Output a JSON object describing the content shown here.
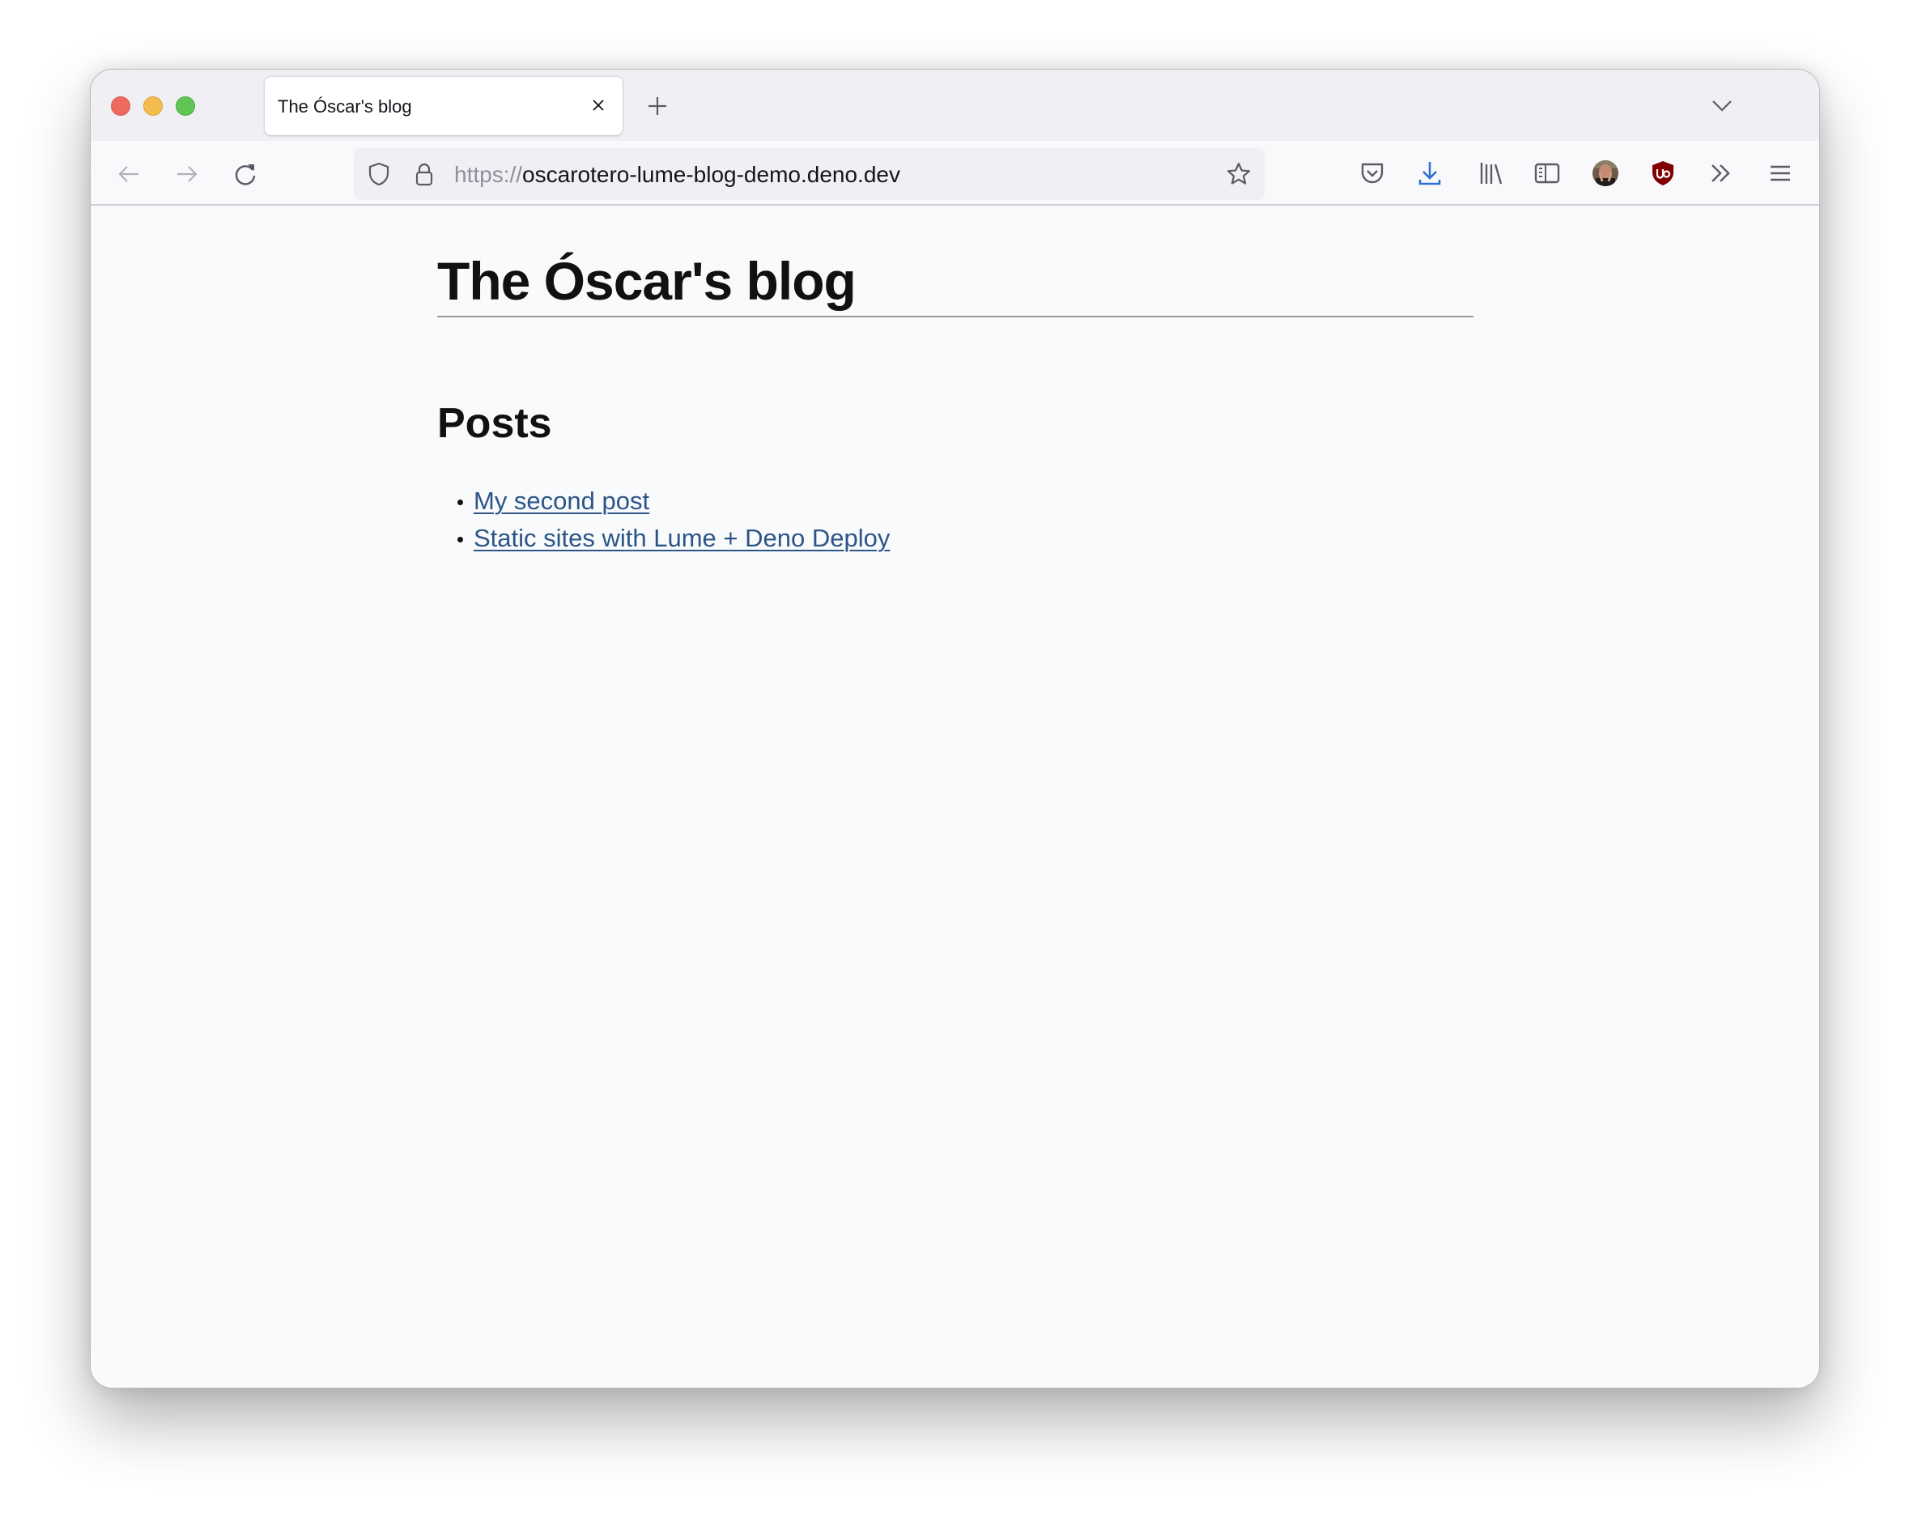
{
  "browser": {
    "tabs": [
      {
        "title": "The Óscar's blog",
        "active": true
      }
    ],
    "url": {
      "scheme": "https://",
      "host": "oscarotero-lume-blog-demo.deno.dev"
    },
    "icons": {
      "window_controls": [
        "close-dot",
        "minimize-dot",
        "maximize-dot"
      ],
      "nav": [
        "back-arrow-icon",
        "forward-arrow-icon",
        "reload-icon"
      ],
      "urlbar": [
        "tracking-shield-icon",
        "lock-icon",
        "bookmark-star-icon"
      ],
      "toolbar": [
        "pocket-icon",
        "download-icon",
        "library-icon",
        "sidebar-icon",
        "account-avatar",
        "ublock-origin-icon",
        "overflow-chevrons-icon",
        "hamburger-menu-icon"
      ]
    },
    "colors": {
      "download_accent": "#2f6fd6",
      "ublock_red": "#800000",
      "link": "#2c5587"
    }
  },
  "page": {
    "site_title": "The Óscar's blog",
    "section_title": "Posts",
    "posts": [
      {
        "title": "My second post"
      },
      {
        "title": "Static sites with Lume + Deno Deploy"
      }
    ]
  }
}
